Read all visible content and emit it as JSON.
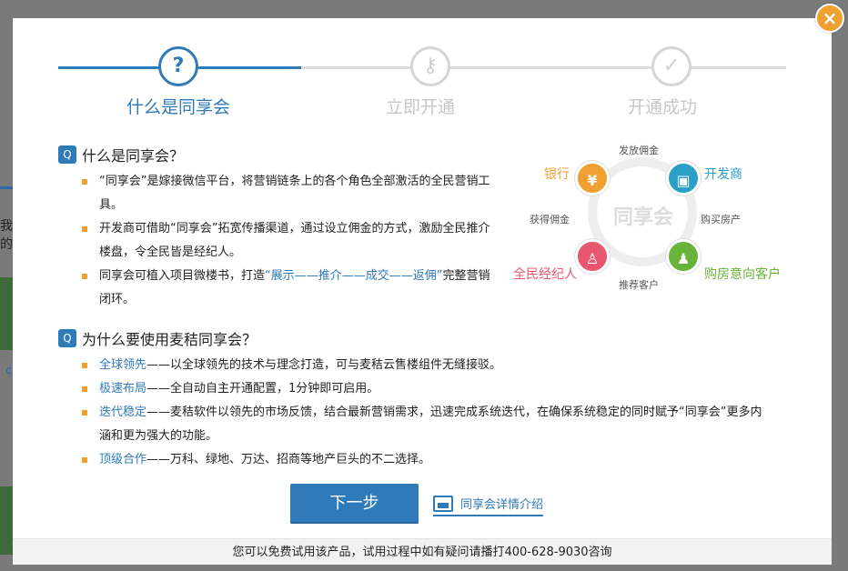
{
  "background": {
    "partial_text": "我的"
  },
  "close": {
    "label": "×"
  },
  "steps": [
    {
      "label": "什么是同享会",
      "icon": "?"
    },
    {
      "label": "立即开通",
      "icon": "⚷"
    },
    {
      "label": "开通成功",
      "icon": "✓"
    }
  ],
  "section1": {
    "title": "什么是同享会？",
    "bullets": [
      {
        "text": "“同享会”是嫁接微信平台，将营销链条上的各个角色全部激活的全民营销工具。"
      },
      {
        "text": "开发商可借助“同享会”拓宽传播渠道，通过设立佣金的方式，激励全民推介楼盘，令全民皆是经纪人。"
      },
      {
        "pre": "同享会可植入项目微楼书，打造",
        "hl": "“展示——推介——成交——返佣”",
        "post": "完整营销闭环。"
      }
    ]
  },
  "section2": {
    "title": "为什么要使用麦秸同享会？",
    "bullets": [
      {
        "hl": "全球领先",
        "text": "——以全球领先的技术与理念打造，可与麦秸云售楼组件无缝接驳。"
      },
      {
        "hl": "极速布局",
        "text": "——全自动自主开通配置，1分钟即可启用。"
      },
      {
        "hl": "迭代稳定",
        "text": "——麦秸软件以领先的市场反馈，结合最新营销需求，迅速完成系统迭代，在确保系统稳定的同时赋予“同享会”更多内涵和更为强大的功能。"
      },
      {
        "hl": "顶级合作",
        "text": "——万科、绿地、万达、招商等地产巨头的不二选择。"
      }
    ]
  },
  "diagram": {
    "center": "同享会",
    "nodes": {
      "bank": "银行",
      "developer": "开发商",
      "customer": "购房意向客户",
      "agent": "全民经纪人"
    },
    "edges": {
      "top": "发放佣金",
      "right": "购买房产",
      "bottom": "推荐客户",
      "left": "获得佣金"
    },
    "colors": {
      "bank": "#f0a030",
      "developer": "#2aa0c8",
      "customer": "#6ab33a",
      "agent": "#e8566f"
    }
  },
  "actions": {
    "next": "下一步",
    "detail": "同享会详情介绍"
  },
  "footer": {
    "text": "您可以免费试用该产品，试用过程中如有疑问请播打400-628-9030咨询"
  }
}
